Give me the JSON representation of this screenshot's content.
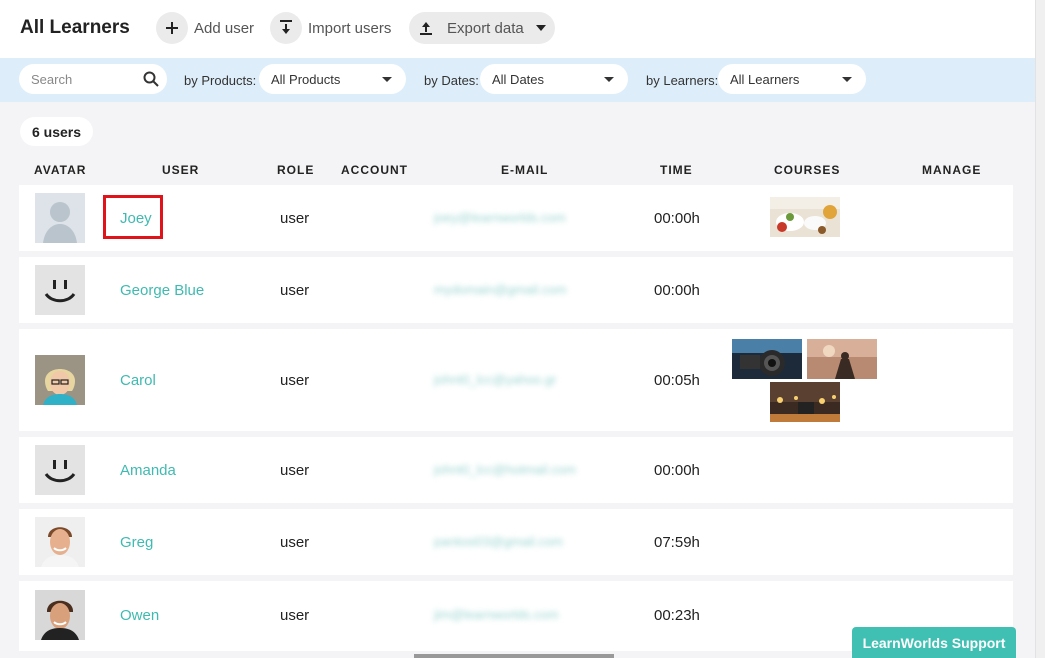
{
  "header": {
    "title": "All Learners",
    "add_user": "Add user",
    "import_users": "Import users",
    "export_data": "Export data"
  },
  "filters": {
    "search_placeholder": "Search",
    "products_label": "by Products:",
    "products_value": "All Products",
    "dates_label": "by Dates:",
    "dates_value": "All Dates",
    "learners_label": "by Learners:",
    "learners_value": "All Learners"
  },
  "count": "6 users",
  "columns": [
    "AVATAR",
    "USER",
    "ROLE",
    "ACCOUNT",
    "E-MAIL",
    "TIME",
    "COURSES",
    "MANAGE"
  ],
  "rows": [
    {
      "name": "Joey",
      "role": "user",
      "email": "joey@learnworlds.com",
      "time": "00:00h"
    },
    {
      "name": "George Blue",
      "role": "user",
      "email": "mydomain@gmail.com",
      "time": "00:00h"
    },
    {
      "name": "Carol",
      "role": "user",
      "email": "johnt0_lcc@yahoo.gr",
      "time": "00:05h"
    },
    {
      "name": "Amanda",
      "role": "user",
      "email": "johnt0_lcc@hotmail.com",
      "time": "00:00h"
    },
    {
      "name": "Greg",
      "role": "user",
      "email": "pantosi03@gmail.com",
      "time": "07:59h"
    },
    {
      "name": "Owen",
      "role": "user",
      "email": "jim@learnworlds.com",
      "time": "00:23h"
    }
  ],
  "support_label": "LearnWorlds Support",
  "colors": {
    "accent": "#3fbab1",
    "filter_bar": "#ddeefa",
    "highlight": "#e0121a"
  }
}
